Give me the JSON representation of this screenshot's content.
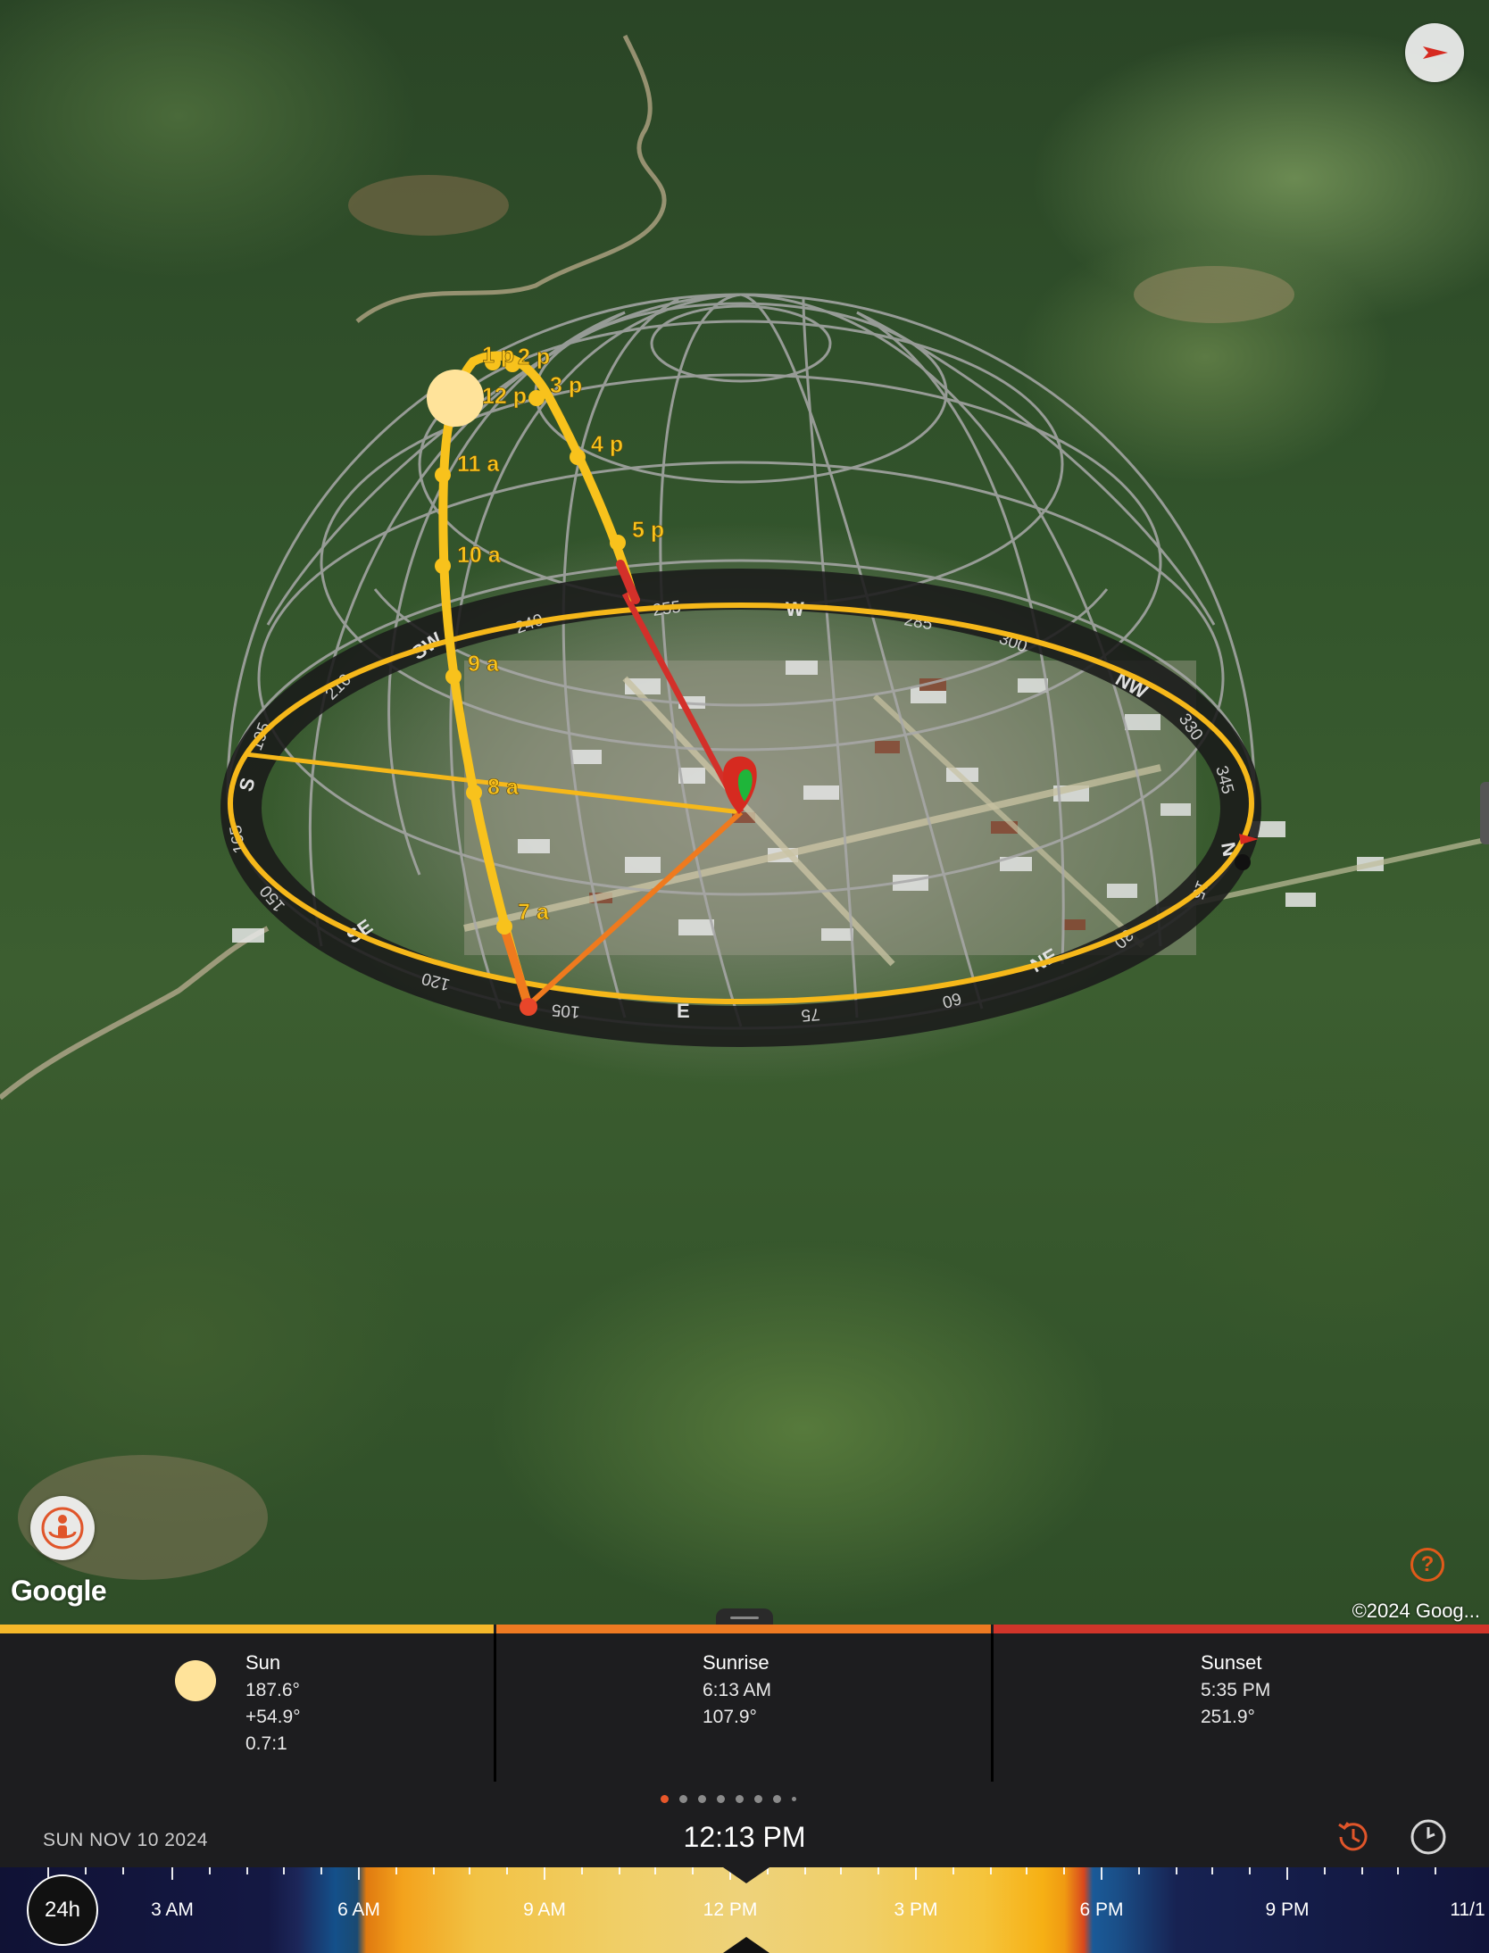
{
  "map": {
    "attribution": "Google",
    "copyright": "©2024 Goog...",
    "help_glyph": "?",
    "hour_labels": [
      "1 p",
      "2 p",
      "12 p",
      "3 p",
      "4 p",
      "5 p",
      "11 a",
      "10 a",
      "9 a",
      "8 a",
      "7 a"
    ],
    "compass_labels": [
      "S",
      "SE",
      "E",
      "NE",
      "N",
      "NW",
      "W",
      "SW",
      "240",
      "210",
      "195",
      "165",
      "150",
      "120",
      "105",
      "75",
      "60",
      "30",
      "15",
      "345",
      "330",
      "300",
      "285",
      "255"
    ],
    "icons": [
      "compass-direction-icon",
      "street-view-person-icon",
      "help-icon"
    ]
  },
  "info": {
    "sun": {
      "title": "Sun",
      "azimuth": "187.6°",
      "elevation": "+54.9°",
      "shadow_ratio": "0.7:1",
      "bar_color": "#f5b82a"
    },
    "sunrise": {
      "title": "Sunrise",
      "time": "6:13 AM",
      "azimuth": "107.9°",
      "bar_color": "#ee7a22"
    },
    "sunset": {
      "title": "Sunset",
      "time": "5:35 PM",
      "azimuth": "251.9°",
      "bar_color": "#d0352a"
    }
  },
  "datebar": {
    "date": "SUN NOV 10 2024",
    "time": "12:13 PM",
    "page_count": 8,
    "active_page": 0,
    "icons": [
      "history-clock-icon",
      "clock-icon"
    ]
  },
  "timeline": {
    "mode_button": "24h",
    "labels": [
      "3 AM",
      "6 AM",
      "9 AM",
      "12 PM",
      "3 PM",
      "6 PM",
      "9 PM",
      "11/1"
    ]
  }
}
